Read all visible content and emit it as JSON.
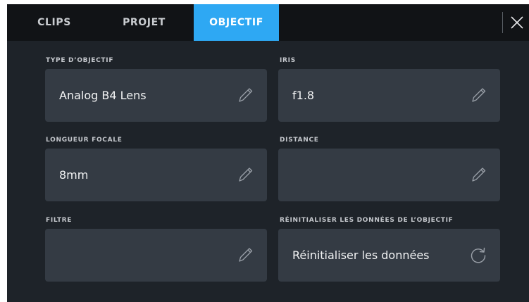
{
  "tabs": [
    {
      "label": "CLIPS",
      "active": false
    },
    {
      "label": "PROJET",
      "active": false
    },
    {
      "label": "OBJECTIF",
      "active": true
    }
  ],
  "close_icon": "close-icon",
  "fields": {
    "lens_type": {
      "label": "TYPE D’OBJECTIF",
      "value": "Analog B4 Lens",
      "icon": "pencil-icon"
    },
    "iris": {
      "label": "IRIS",
      "value": "f1.8",
      "icon": "pencil-icon"
    },
    "focal_length": {
      "label": "LONGUEUR FOCALE",
      "value": "8mm",
      "icon": "pencil-icon"
    },
    "distance": {
      "label": "DISTANCE",
      "value": "",
      "icon": "pencil-icon"
    },
    "filter": {
      "label": "FILTRE",
      "value": "",
      "icon": "pencil-icon"
    },
    "reset": {
      "label": "RÉINITIALISER LES DONNÉES DE L’OBJECTIF",
      "value": "Réinitialiser les données",
      "icon": "refresh-icon"
    }
  },
  "colors": {
    "background": "#1e2329",
    "tab_bar": "#111316",
    "active_tab": "#2ea8f3",
    "field_box": "#343b44"
  }
}
